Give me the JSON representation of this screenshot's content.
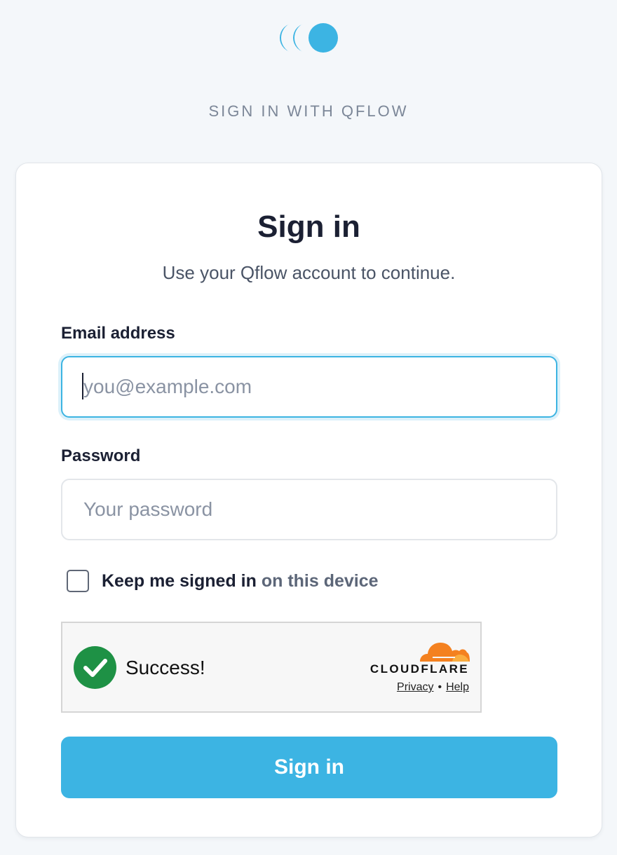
{
  "brand": {
    "caption": "SIGN IN WITH QFLOW",
    "logo_icon": "qflow-logo-icon",
    "accent_color": "#3cb4e3"
  },
  "card": {
    "title": "Sign in",
    "subtitle": "Use your Qflow account to continue."
  },
  "form": {
    "email": {
      "label": "Email address",
      "placeholder": "you@example.com",
      "value": ""
    },
    "password": {
      "label": "Password",
      "placeholder": "Your password",
      "value": ""
    },
    "remember": {
      "label_main": "Keep me signed in",
      "label_muted": "on this device",
      "checked": false
    },
    "submit_label": "Sign in"
  },
  "captcha": {
    "status_icon": "check-circle-icon",
    "status_text": "Success!",
    "provider": "CLOUDFLARE",
    "provider_icon": "cloudflare-cloud-icon",
    "privacy_label": "Privacy",
    "separator": "•",
    "help_label": "Help",
    "success_color": "#1e9145"
  }
}
